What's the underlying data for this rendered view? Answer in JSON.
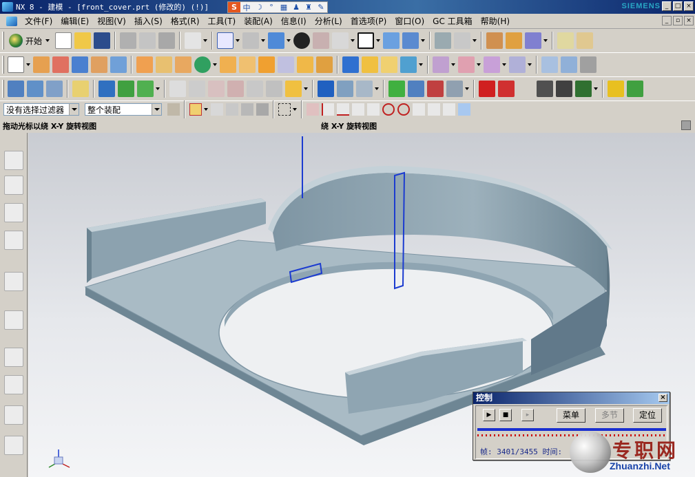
{
  "window": {
    "title": "NX 8 - 建模 - [front_cover.prt (修改的) (!)]",
    "brand": "SIEMENS"
  },
  "ime_bar": {
    "mode": "中",
    "icons": [
      "sogou-icon",
      "moon-icon",
      "keyboard-icon",
      "shirt-icon",
      "wrench-icon"
    ]
  },
  "menu": {
    "items": [
      "文件(F)",
      "编辑(E)",
      "视图(V)",
      "插入(S)",
      "格式(R)",
      "工具(T)",
      "装配(A)",
      "信息(I)",
      "分析(L)",
      "首选项(P)",
      "窗口(O)",
      "GC 工具箱",
      "帮助(H)"
    ]
  },
  "toolbar": {
    "start_label": "开始"
  },
  "selection": {
    "filter_value": "没有选择过滤器",
    "scope_value": "整个装配"
  },
  "status": {
    "cue": "拖动光标以绕 X-Y 旋转视图",
    "message": "绕 X-Y 旋转视图"
  },
  "control_dialog": {
    "title": "控制",
    "menu_label": "菜单",
    "multi_step_label": "多节",
    "position_label": "定位",
    "frame_label": "帧: 3401/3455 时间:"
  },
  "watermark": {
    "cn": "专职网",
    "en": "Zhuanzhi.Net"
  },
  "colors": {
    "title_blue": "#0a246a",
    "ui_gray": "#d4d0c8",
    "model_face": "#8ea4b2",
    "model_edge": "#6e8694",
    "selection_blue": "#1b3bd0"
  }
}
